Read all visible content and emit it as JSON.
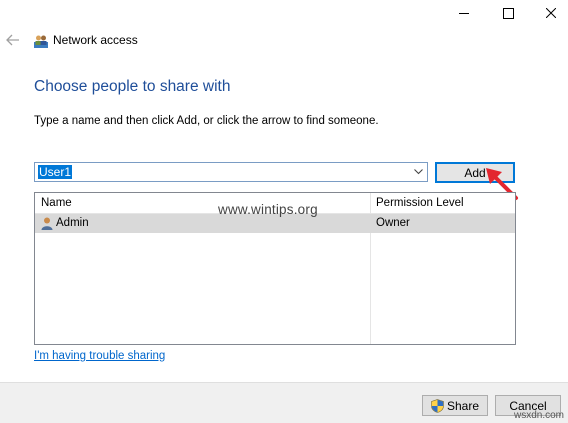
{
  "window": {
    "title": "Network access",
    "controls": {
      "minimize": "—",
      "maximize": "☐",
      "close": "✕"
    }
  },
  "content": {
    "heading": "Choose people to share with",
    "instruction": "Type a name and then click Add, or click the arrow to find someone."
  },
  "name_input": {
    "value": "User1"
  },
  "add_button": {
    "label": "Add"
  },
  "table": {
    "columns": [
      "Name",
      "Permission Level"
    ],
    "rows": [
      {
        "name": "Admin",
        "permission": "Owner"
      }
    ]
  },
  "watermark": "www.wintips.org",
  "trouble_link": "I'm having trouble sharing",
  "footer": {
    "share_label": "Share",
    "cancel_label": "Cancel"
  },
  "site_badge": "wsxdn.com",
  "colors": {
    "heading": "#1f4e99",
    "accent": "#0078d7",
    "link": "#0066cc",
    "annotation_arrow": "#e3262f"
  },
  "icons": {
    "back": "left-arrow-icon",
    "app": "network-people-icon",
    "dropdown": "chevron-down-icon",
    "user": "user-icon",
    "shield": "uac-shield-icon"
  }
}
